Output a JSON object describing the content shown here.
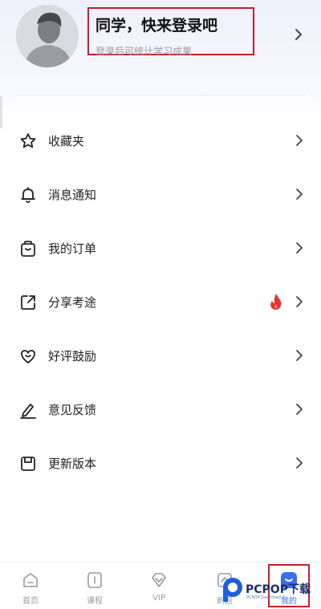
{
  "profile": {
    "title": "同学，快来登录吧",
    "subtitle": "登录后可统计学习成果",
    "avatar_icon": "default-avatar-icon",
    "chevron_icon": "chevron-right-icon"
  },
  "menu": {
    "items": [
      {
        "label": "收藏夹",
        "icon": "star-icon"
      },
      {
        "label": "消息通知",
        "icon": "bell-icon"
      },
      {
        "label": "我的订单",
        "icon": "order-bag-icon"
      },
      {
        "label": "分享考途",
        "icon": "share-icon",
        "badge_icon": "fire-icon"
      },
      {
        "label": "好评鼓励",
        "icon": "heart-icon"
      },
      {
        "label": "意见反馈",
        "icon": "pencil-icon"
      },
      {
        "label": "更新版本",
        "icon": "update-icon"
      }
    ]
  },
  "tabbar": {
    "tabs": [
      {
        "label": "首页",
        "icon": "home-icon"
      },
      {
        "label": "课程",
        "icon": "course-icon"
      },
      {
        "label": "VIP",
        "icon": "vip-diamond-icon"
      },
      {
        "label": "刷题",
        "icon": "practice-icon"
      },
      {
        "label": "我的",
        "icon": "profile-tab-icon",
        "active": true
      }
    ]
  },
  "watermark": {
    "text": "PCPOP下载",
    "sub": "PCPOP Download"
  },
  "colors": {
    "highlight_border": "#c81e2a",
    "accent": "#3a6df0",
    "fire": "#e8322e"
  }
}
